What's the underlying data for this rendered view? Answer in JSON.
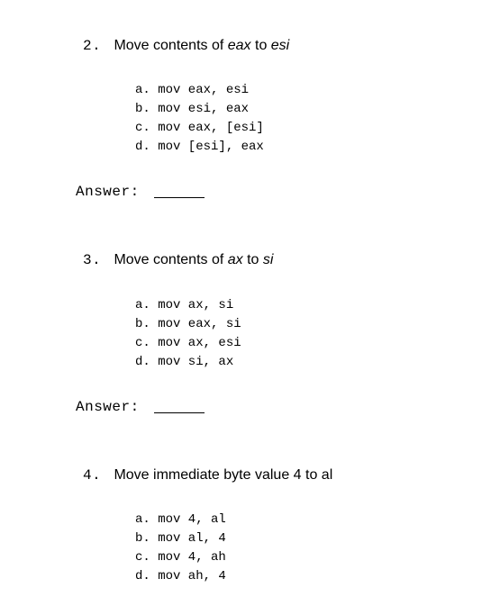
{
  "questions": [
    {
      "number": "2.",
      "prompt_pre": "Move contents of ",
      "prompt_reg1": "eax",
      "prompt_mid": " to ",
      "prompt_reg2": "esi",
      "options": {
        "a": "a. mov eax, esi",
        "b": "b. mov esi, eax",
        "c": "c. mov eax, [esi]",
        "d": "d. mov [esi], eax"
      },
      "answer_label": "Answer:"
    },
    {
      "number": "3.",
      "prompt_pre": "Move contents of ",
      "prompt_reg1": "ax",
      "prompt_mid": " to ",
      "prompt_reg2": "si",
      "options": {
        "a": "a. mov ax, si",
        "b": "b. mov eax, si",
        "c": "c. mov ax, esi",
        "d": "d. mov si, ax"
      },
      "answer_label": "Answer:"
    },
    {
      "number": "4.",
      "prompt_full": "Move immediate byte value 4 to al",
      "options": {
        "a": "a. mov 4, al",
        "b": "b. mov al, 4",
        "c": "c. mov 4, ah",
        "d": "d. mov ah, 4"
      }
    }
  ]
}
